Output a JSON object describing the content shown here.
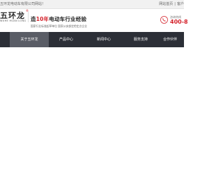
{
  "topbar": {
    "welcome": "五环龙电动车有限公司网站！",
    "links": [
      "网站首页",
      "客户"
    ]
  },
  "logo": {
    "brand": "五环龙",
    "reg": "®",
    "sub": "WUHE HUAN LONG"
  },
  "slogan": {
    "headline_prefix": "造",
    "headline_accent": "10年",
    "headline_suffix": "电动车行业经验",
    "desc": "国家行业标准起草单位  国家公安部定检定点企业"
  },
  "hotline": {
    "label": "咨询热线",
    "number": "400-8",
    "icon": "phone-icon"
  },
  "nav": {
    "items": [
      {
        "label": "关于五环龙",
        "active": true
      },
      {
        "label": "产品中心",
        "active": false
      },
      {
        "label": "新闻中心",
        "active": false
      },
      {
        "label": "服务支持",
        "active": false
      },
      {
        "label": "合作伙伴",
        "active": false
      }
    ]
  },
  "colors": {
    "accent": "#d4212a",
    "nav_bg": "#2c2f37",
    "nav_active": "#5a5d66"
  }
}
